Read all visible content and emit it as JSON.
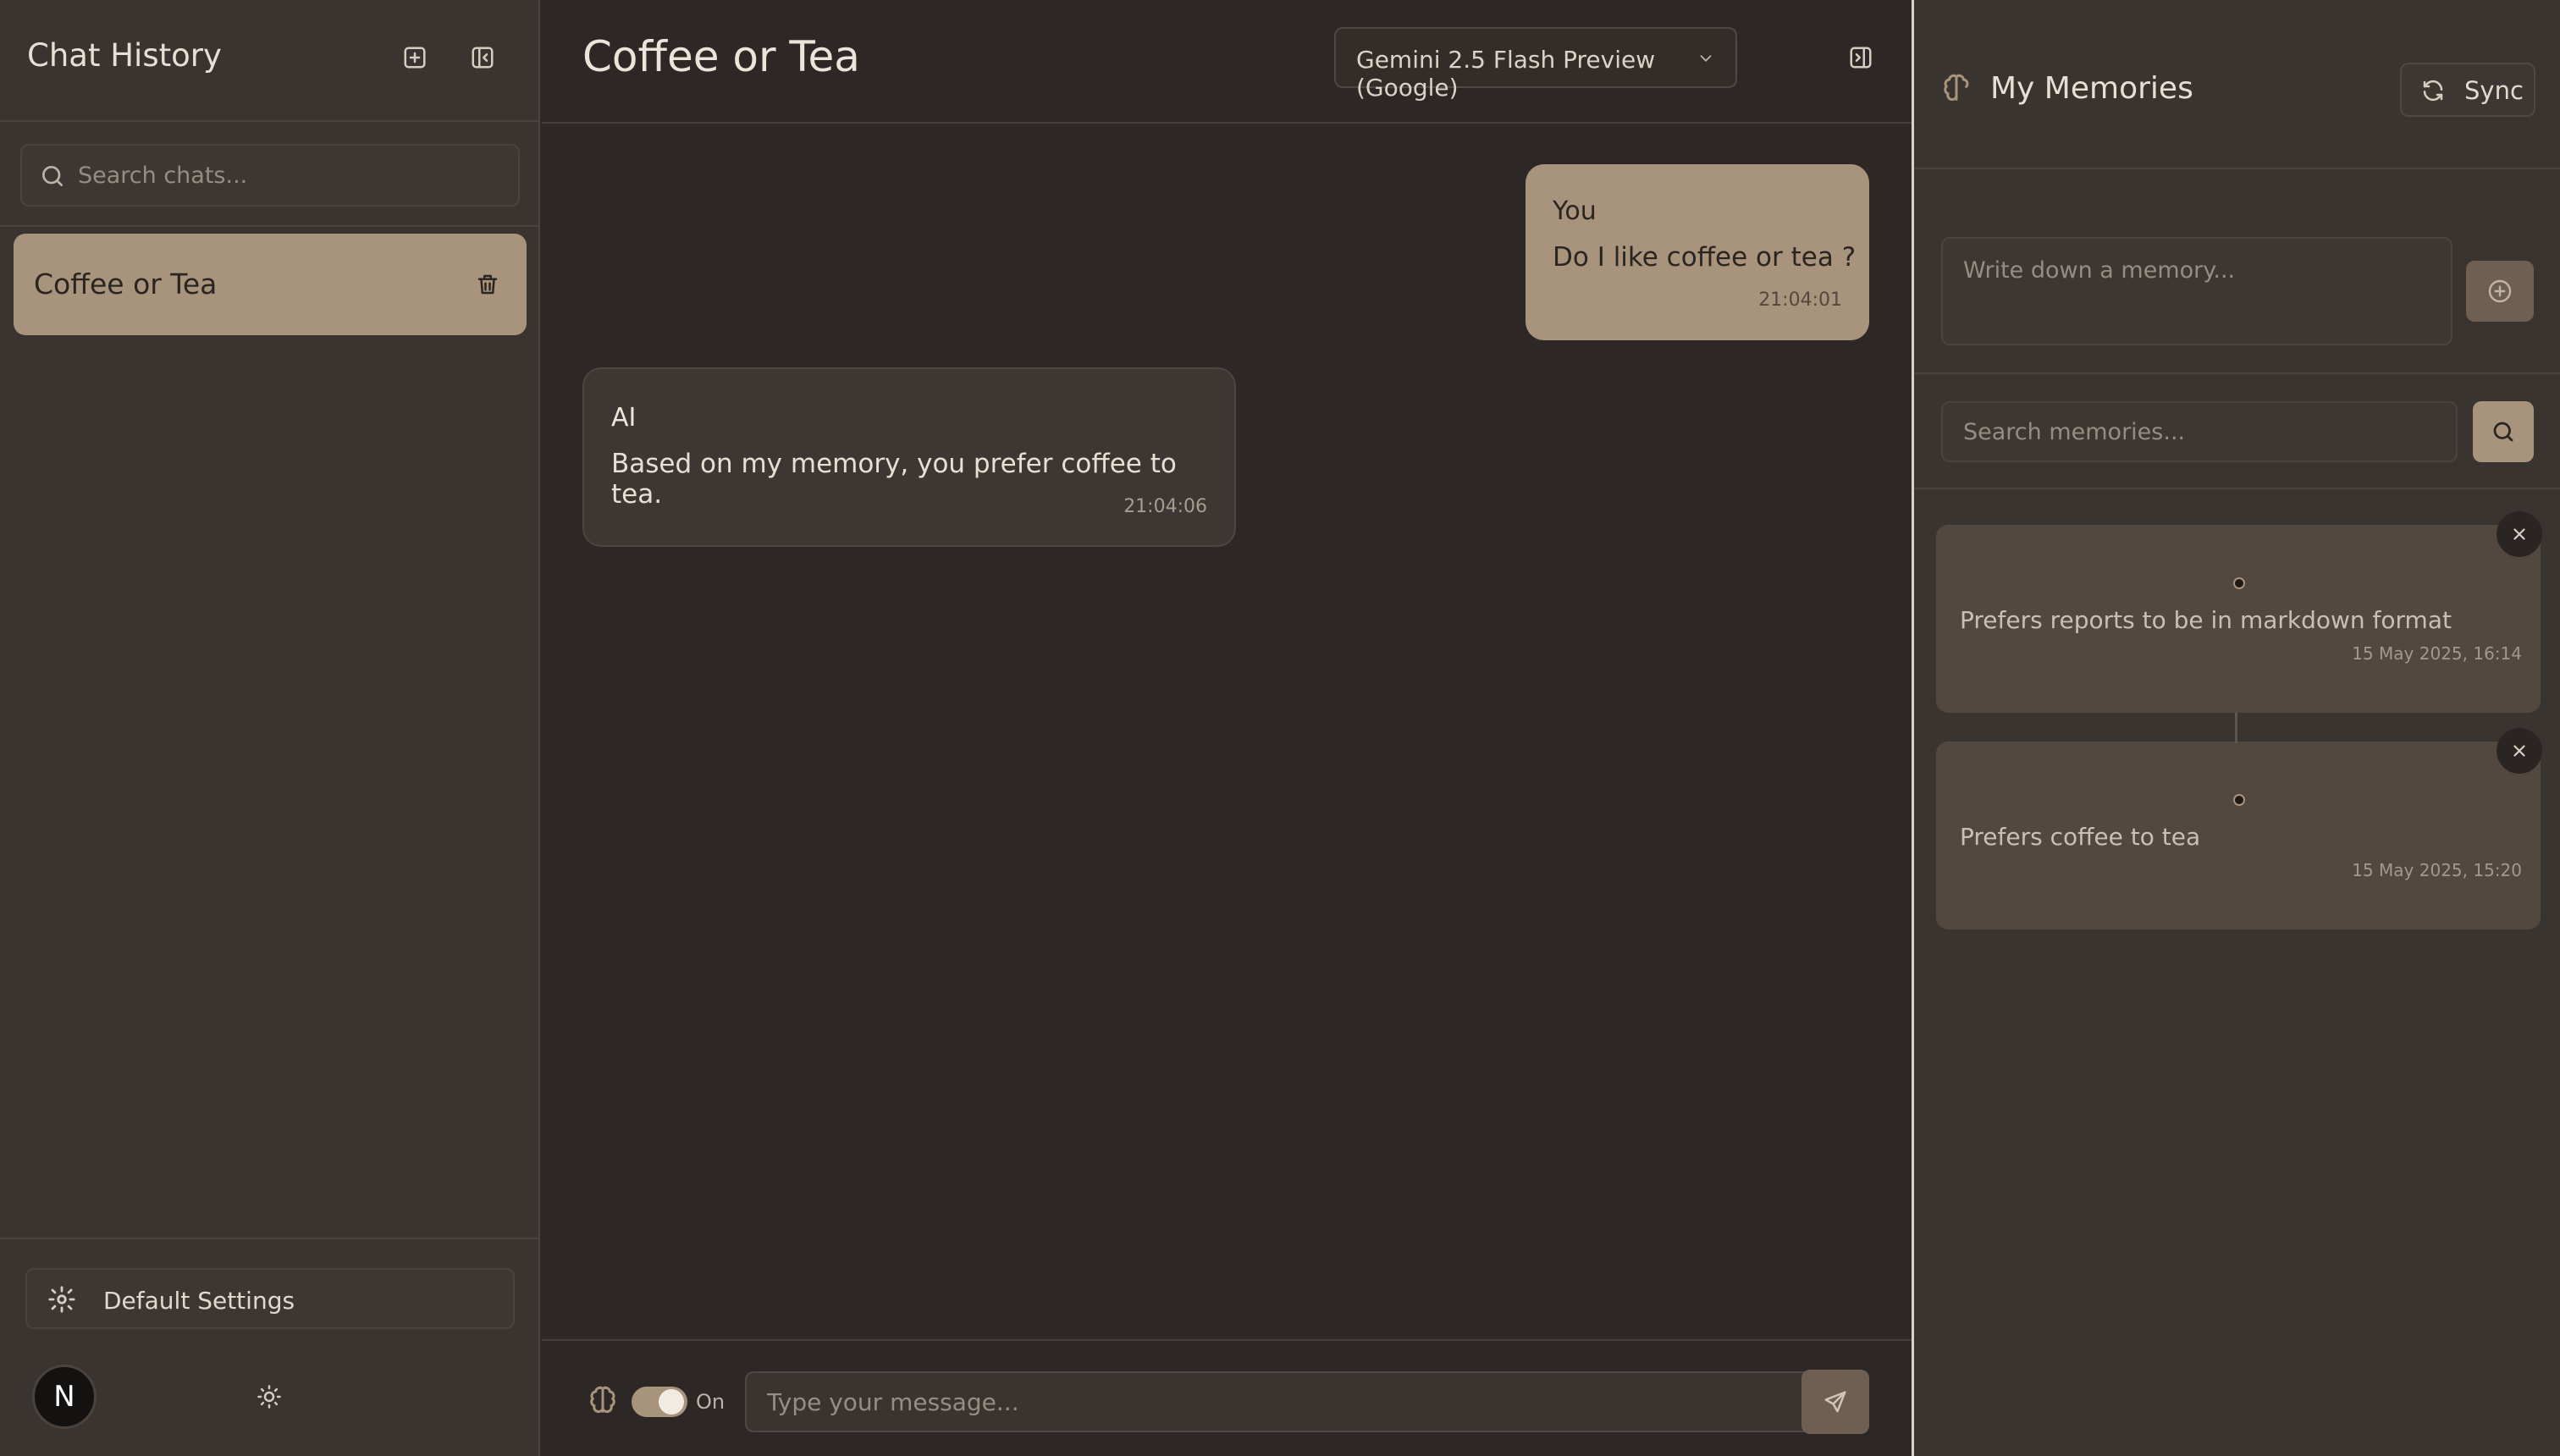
{
  "sidebar": {
    "title": "Chat History",
    "new_chat_icon": "plus-square-icon",
    "collapse_icon": "panel-left-close-icon",
    "search_placeholder": "Search chats...",
    "chats": [
      {
        "label": "Coffee or Tea",
        "active": true
      }
    ],
    "settings_label": "Default Settings",
    "avatar_initial": "N",
    "theme_icon": "sun-icon"
  },
  "main": {
    "title": "Coffee or Tea",
    "model": "Gemini 2.5 Flash Preview (Google)",
    "messages": [
      {
        "role": "user",
        "sender": "You",
        "text": "Do I like coffee or tea ?",
        "time": "21:04:01"
      },
      {
        "role": "ai",
        "sender": "AI",
        "text": "Based on my memory, you prefer coffee to tea.",
        "time": "21:04:06"
      }
    ],
    "composer": {
      "memory_toggle_label": "On",
      "memory_toggle_on": true,
      "input_placeholder": "Type your message..."
    }
  },
  "memory": {
    "title": "My Memories",
    "sync_label": "Sync",
    "add_placeholder": "Write down a memory...",
    "search_placeholder": "Search memories...",
    "items": [
      {
        "text": "Prefers reports to be in markdown format",
        "time": "15 May 2025, 16:14"
      },
      {
        "text": "Prefers coffee to tea",
        "time": "15 May 2025, 15:20"
      }
    ]
  },
  "colors": {
    "accent": "#a8937c",
    "background": "#2d2825",
    "sidebar": "#3a3430",
    "memory_card": "#524840"
  }
}
